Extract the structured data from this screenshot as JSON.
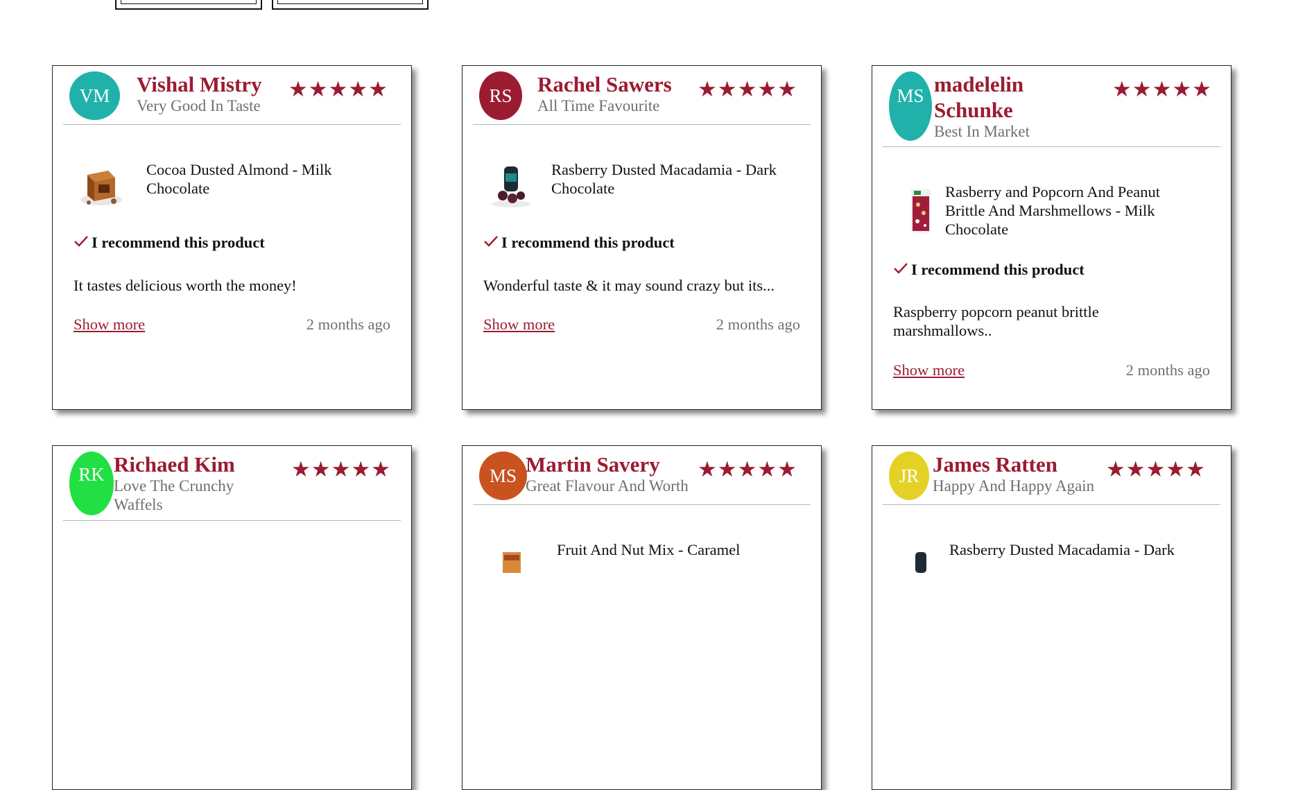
{
  "colors": {
    "accent": "#9b1b30",
    "muted": "#6f6f6f"
  },
  "recommend_label": "I recommend this product",
  "show_more_label": "Show more",
  "reviews": [
    {
      "initials": "VM",
      "avatar_color": "#20b2aa",
      "name": "Vishal Mistry",
      "title": "Very Good In Taste",
      "rating": 5,
      "stars": "★★★★★",
      "product": "Cocoa Dusted Almond - Milk Chocolate",
      "product_icon": "almond-box-image",
      "recommend": true,
      "text": "It tastes delicious worth the money!",
      "time": "2 months ago"
    },
    {
      "initials": "RS",
      "avatar_color": "#9b1b30",
      "name": "Rachel Sawers",
      "title": "All Time Favourite",
      "rating": 5,
      "stars": "★★★★★",
      "product": "Rasberry Dusted Macadamia - Dark Chocolate",
      "product_icon": "macadamia-jar-image",
      "recommend": true,
      "text": "Wonderful taste & it may sound crazy but its...",
      "time": "2 months ago"
    },
    {
      "initials": "MS",
      "avatar_color": "#20b2aa",
      "name": "madelelin Schunke",
      "title": "Best In Market",
      "rating": 5,
      "stars": "★★★★★",
      "product": "Rasberry and Popcorn And Peanut Brittle And Marshmellows - Milk Chocolate",
      "product_icon": "chocolate-bar-image",
      "recommend": true,
      "text": "Raspberry popcorn peanut brittle marshmallows..",
      "time": "2 months ago"
    },
    {
      "initials": "RK",
      "avatar_color": "#22e044",
      "name": "Richaed Kim",
      "title": "Love The Crunchy Waffels",
      "rating": 5,
      "stars": "★★★★★"
    },
    {
      "initials": "MS",
      "avatar_color": "#c8531f",
      "name": "Martin Savery",
      "title": "Great Flavour And Worth",
      "rating": 5,
      "stars": "★★★★★",
      "product": "Fruit And Nut Mix - Caramel",
      "product_icon": "fruit-nut-box-image"
    },
    {
      "initials": "JR",
      "avatar_color": "#e3d225",
      "name": "James Ratten",
      "title": "Happy And Happy Again",
      "rating": 5,
      "stars": "★★★★★",
      "product": "Rasberry Dusted Macadamia - Dark",
      "product_icon": "macadamia-jar-image"
    }
  ]
}
